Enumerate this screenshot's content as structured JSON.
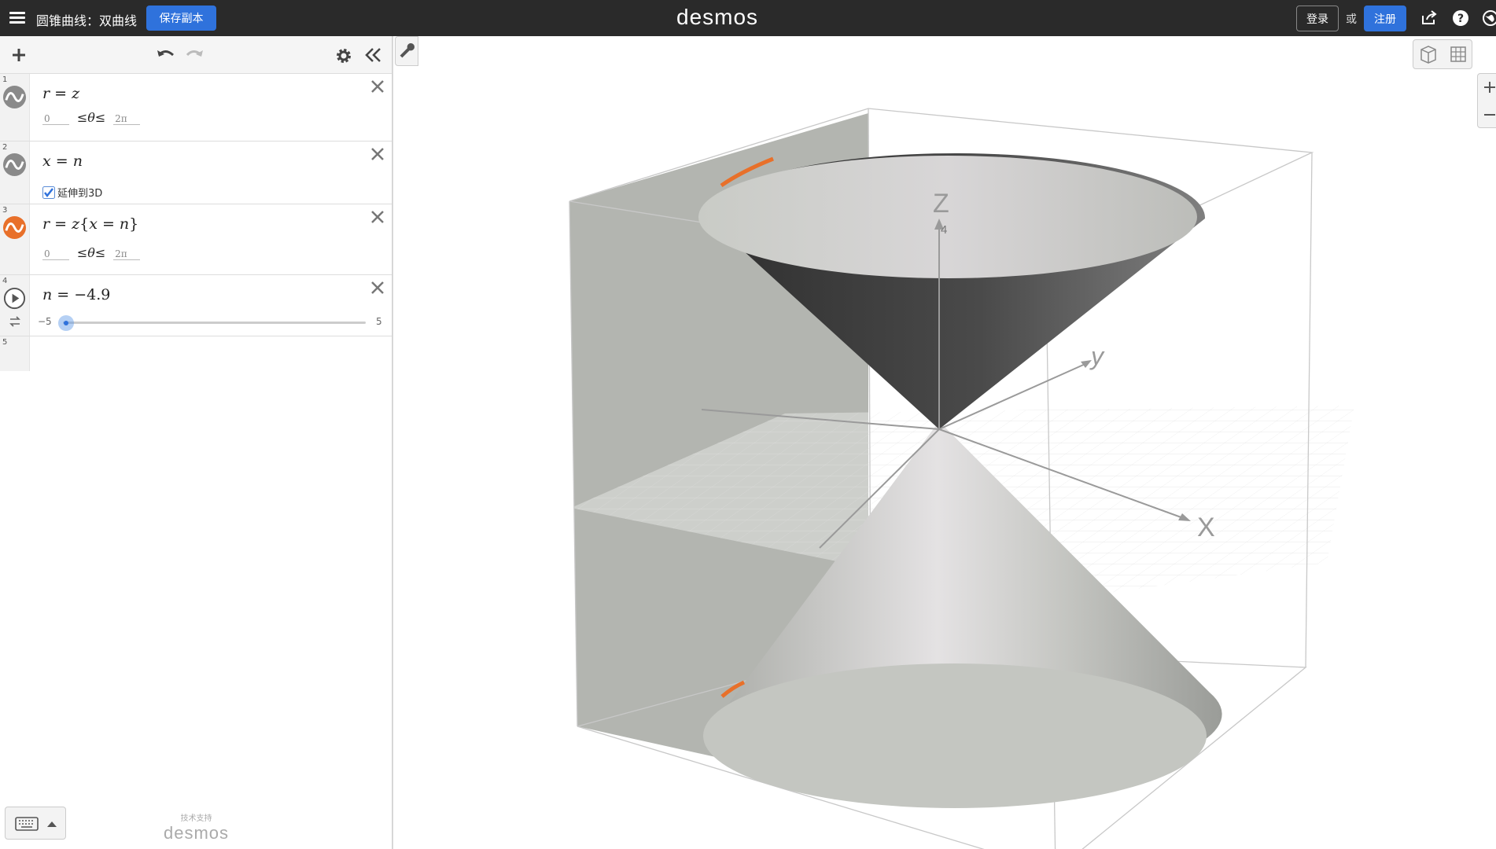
{
  "header": {
    "title": "圆锥曲线：双曲线",
    "save_label": "保存副本",
    "brand": "desmos",
    "login_label": "登录",
    "or_label": "或",
    "signup_label": "注册"
  },
  "expressions": [
    {
      "index": "1",
      "formula_lhs": "r",
      "formula_rhs": "z",
      "color": "#888888",
      "bounds": {
        "min": "0",
        "param": "θ",
        "max": "2π"
      }
    },
    {
      "index": "2",
      "formula_lhs": "x",
      "formula_rhs": "n",
      "color": "#888888",
      "checkbox_label": "延伸到3D",
      "checkbox_checked": true
    },
    {
      "index": "3",
      "formula_lhs": "r",
      "formula_rhs": "z",
      "restriction_lhs": "x",
      "restriction_rhs": "n",
      "color": "#e8702a",
      "bounds": {
        "min": "0",
        "param": "θ",
        "max": "2π"
      }
    },
    {
      "index": "4",
      "formula_lhs": "n",
      "formula_rhs": "−4.9",
      "slider": {
        "min": "−5",
        "max": "5",
        "value": -4.9
      }
    },
    {
      "index": "5"
    }
  ],
  "footer": {
    "powered_small": "技术支持",
    "powered_brand": "desmos"
  },
  "graph": {
    "axis_x": "X",
    "axis_y": "y",
    "axis_z": "Z",
    "z_tick": "4",
    "accent_color": "#e8702a",
    "surface_color": "#b9bbb6"
  }
}
